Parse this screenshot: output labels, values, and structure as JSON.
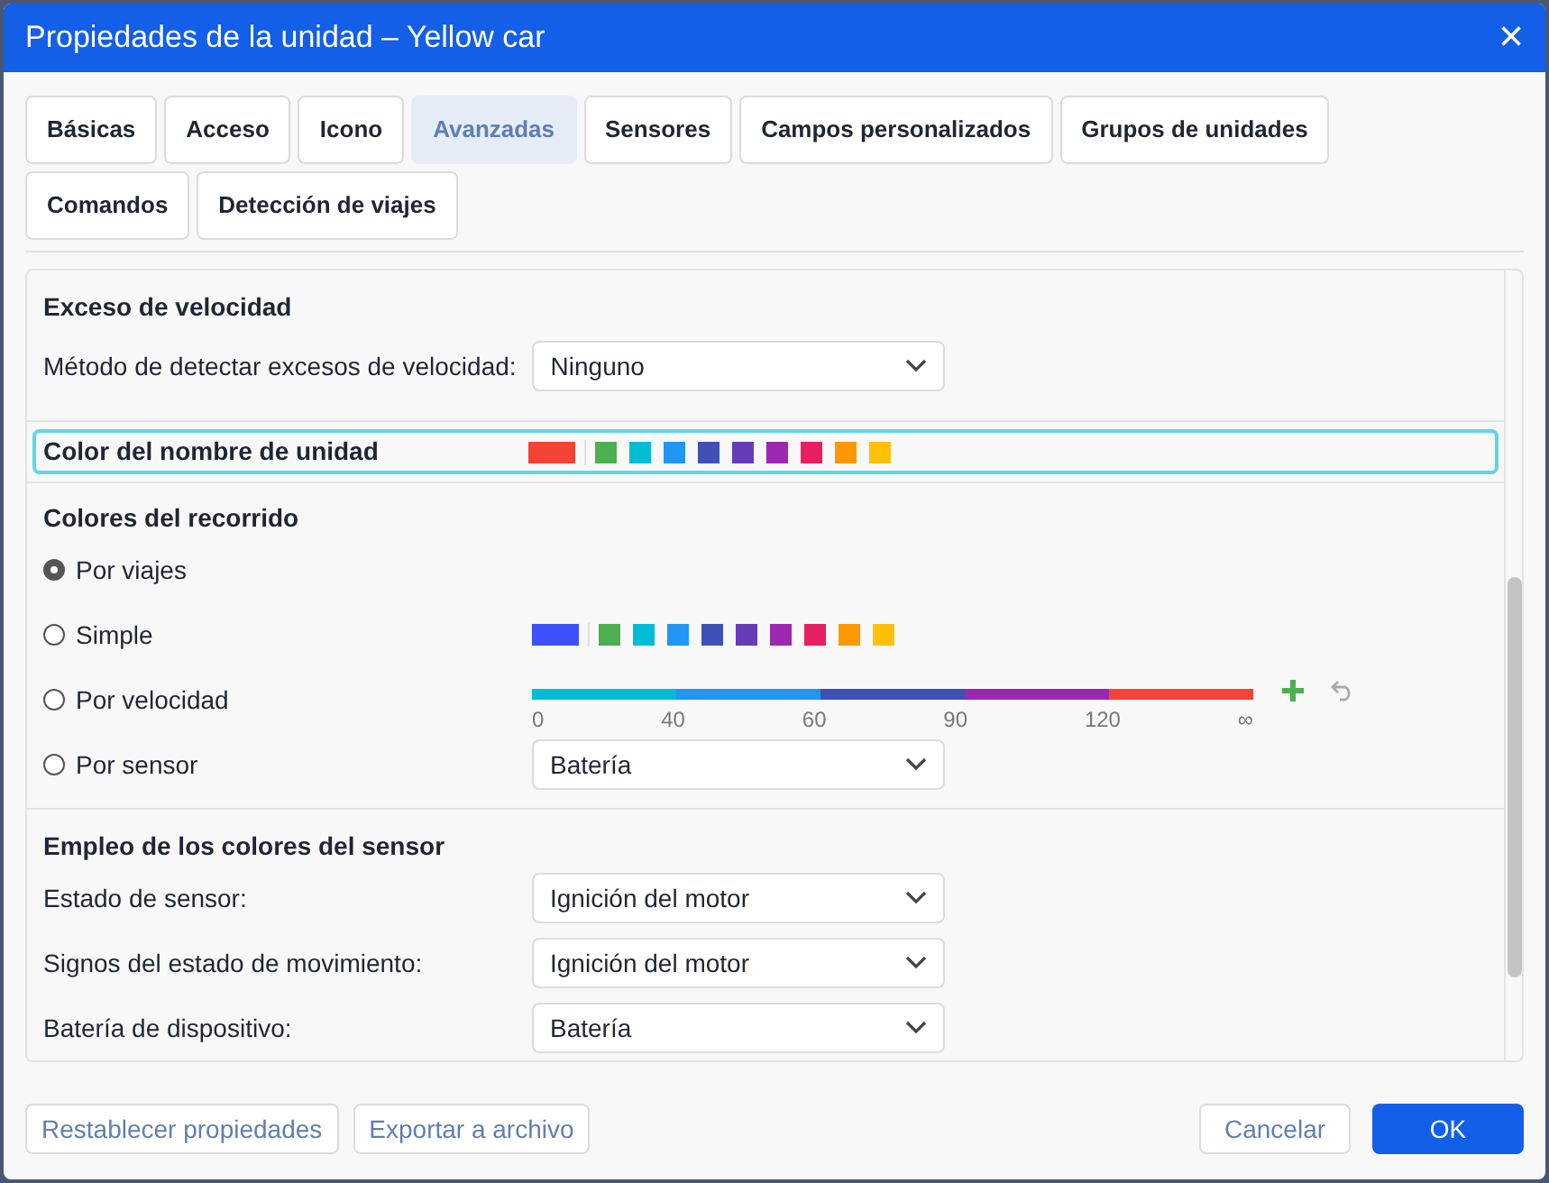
{
  "window": {
    "title": "Propiedades de la unidad – Yellow car",
    "close": "×"
  },
  "tabs": [
    {
      "label": "Básicas",
      "selected": false
    },
    {
      "label": "Acceso",
      "selected": false
    },
    {
      "label": "Icono",
      "selected": false
    },
    {
      "label": "Avanzadas",
      "selected": true
    },
    {
      "label": "Sensores",
      "selected": false
    },
    {
      "label": "Campos personalizados",
      "selected": false
    },
    {
      "label": "Grupos de unidades",
      "selected": false
    },
    {
      "label": "Comandos",
      "selected": false
    },
    {
      "label": "Detección de viajes",
      "selected": false
    }
  ],
  "speeding": {
    "title": "Exceso de velocidad",
    "label": "Método de detectar excesos de velocidad:",
    "value": "Ninguno"
  },
  "unit_name_color": {
    "label": "Color del nombre de unidad",
    "focused": true,
    "current": {
      "color": "#f44336"
    },
    "palette": [
      {
        "color": "#4caf50"
      },
      {
        "color": "#00bcd4"
      },
      {
        "color": "#2196f3"
      },
      {
        "color": "#3f51b5"
      },
      {
        "color": "#673ab7"
      },
      {
        "color": "#9c27b0"
      },
      {
        "color": "#e91e63"
      },
      {
        "color": "#ff9800"
      },
      {
        "color": "#ffc107"
      }
    ]
  },
  "track_colors": {
    "title": "Colores del recorrido",
    "options": [
      {
        "kind": "none",
        "label": "Por viajes",
        "selected": true
      },
      {
        "kind": "palette",
        "label": "Simple",
        "selected": false,
        "current": {
          "color": "#3d50fa"
        },
        "palette": [
          {
            "color": "#4caf50"
          },
          {
            "color": "#00bcd4"
          },
          {
            "color": "#2196f3"
          },
          {
            "color": "#3f51b5"
          },
          {
            "color": "#673ab7"
          },
          {
            "color": "#9c27b0"
          },
          {
            "color": "#e91e63"
          },
          {
            "color": "#ff9800"
          },
          {
            "color": "#ffc107"
          }
        ]
      },
      {
        "kind": "speed",
        "label": "Por velocidad",
        "selected": false,
        "segments": [
          {
            "color": "#00bcd4"
          },
          {
            "color": "#2196f3"
          },
          {
            "color": "#3f51b5"
          },
          {
            "color": "#9c27b0"
          },
          {
            "color": "#f44336"
          }
        ],
        "ticks": [
          "0",
          "40",
          "60",
          "90",
          "120",
          "∞"
        ]
      },
      {
        "kind": "select",
        "label": "Por sensor",
        "selected": false,
        "value": "Batería"
      }
    ]
  },
  "sensor_colors": {
    "title": "Empleo de los colores del sensor",
    "rows": [
      {
        "label": "Estado de sensor:",
        "value": "Ignición del motor"
      },
      {
        "label": "Signos del estado de movimiento:",
        "value": "Ignición del motor"
      },
      {
        "label": "Batería de dispositivo:",
        "value": "Batería"
      }
    ]
  },
  "footer": {
    "left": [
      "Restablecer propiedades",
      "Exportar a archivo"
    ],
    "cancel": "Cancelar",
    "ok": "OK"
  }
}
